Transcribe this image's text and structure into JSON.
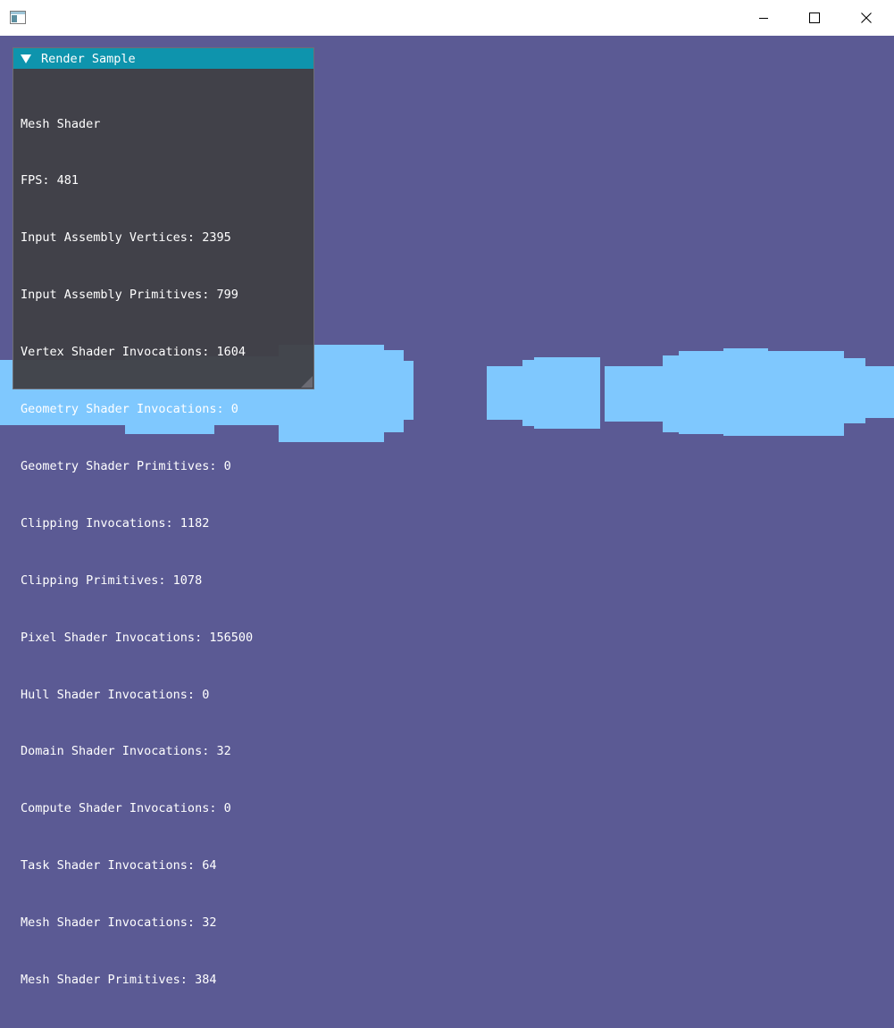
{
  "window": {
    "title": "",
    "icons": {
      "app": "app-window-icon",
      "minimize": "minimize-icon",
      "maximize": "maximize-icon",
      "close": "close-icon"
    }
  },
  "scene": {
    "background_color": "#5b5a94",
    "mesh_color": "#7fc8fe"
  },
  "panel": {
    "title": "Render Sample",
    "header_color": "#0e94ad",
    "lines": [
      "Mesh Shader",
      "FPS: 481",
      "Input Assembly Vertices: 2395",
      "Input Assembly Primitives: 799",
      "Vertex Shader Invocations: 1604",
      "Geometry Shader Invocations: 0",
      "Geometry Shader Primitives: 0",
      "Clipping Invocations: 1182",
      "Clipping Primitives: 1078",
      "Pixel Shader Invocations: 156500",
      "Hull Shader Invocations: 0",
      "Domain Shader Invocations: 32",
      "Compute Shader Invocations: 0",
      "Task Shader Invocations: 64",
      "Mesh Shader Invocations: 32",
      "Mesh Shader Primitives: 384"
    ]
  }
}
